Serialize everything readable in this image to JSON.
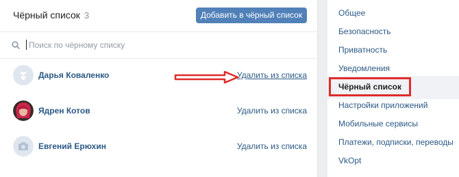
{
  "header": {
    "title": "Чёрный список",
    "count": "3",
    "add_button": "Добавить в чёрный список"
  },
  "search": {
    "placeholder": "Поиск по чёрному списку"
  },
  "users": [
    {
      "name": "Дарья Коваленко",
      "action": "Удалить из списка",
      "avatar": "default-avatar"
    },
    {
      "name": "Ядрен Котов",
      "action": "Удалить из списка",
      "avatar": "photo-avatar"
    },
    {
      "name": "Евгений Ерюхин",
      "action": "Удалить из списка",
      "avatar": "camera-avatar"
    }
  ],
  "sidebar": {
    "items": [
      {
        "label": "Общее"
      },
      {
        "label": "Безопасность"
      },
      {
        "label": "Приватность"
      },
      {
        "label": "Уведомления"
      },
      {
        "label": "Чёрный список",
        "active": true
      },
      {
        "label": "Настройки приложений"
      },
      {
        "label": "Мобильные сервисы"
      },
      {
        "label": "Платежи, подписки, переводы"
      },
      {
        "label": "VkOpt"
      }
    ]
  },
  "colors": {
    "accent": "#5181b8",
    "link": "#2a5885",
    "annotation_red": "#e02a2a"
  }
}
